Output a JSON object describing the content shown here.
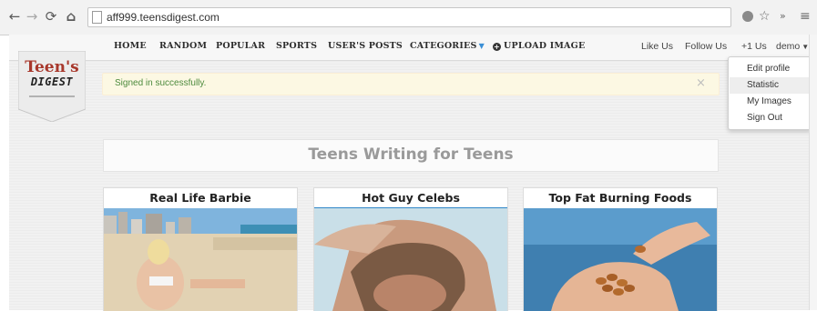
{
  "browser": {
    "url": "aff999.teensdigest.com",
    "back_icon": "arrow-left-icon",
    "forward_icon": "arrow-right-icon",
    "reload_icon": "reload-icon",
    "home_icon": "home-icon"
  },
  "logo": {
    "line1": "Teen's",
    "line2": "DIGEST",
    "line3": "",
    "brand_color": "#a8382c"
  },
  "nav": {
    "items": [
      "HOME",
      "RANDOM",
      "POPULAR",
      "SPORTS",
      "USER'S POSTS",
      "CATEGORIES",
      "UPLOAD IMAGE"
    ],
    "right": [
      "Like Us",
      "Follow Us",
      "+1 Us",
      "demo"
    ],
    "accent": "#3a8fd6"
  },
  "alert": {
    "message": "Signed in successfully.",
    "close": "×",
    "text_color": "#4c8a3c"
  },
  "site_title": "Teens Writing for Teens",
  "cards": [
    {
      "title": "Real Life Barbie"
    },
    {
      "title": "Hot Guy Celebs"
    },
    {
      "title": "Top Fat Burning Foods"
    }
  ],
  "dropdown": {
    "items": [
      "Edit profile",
      "Statistic",
      "My Images",
      "Sign Out"
    ],
    "highlighted": "Statistic"
  }
}
